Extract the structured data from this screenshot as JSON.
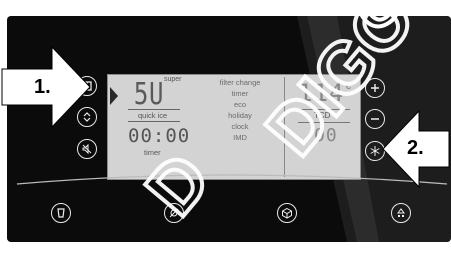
{
  "lcd": {
    "super_label": "super",
    "left_digits": "5U",
    "quick_ice_label": "quick ice",
    "time_digits": "00:00",
    "timer_label": "timer",
    "menu": [
      "filter change",
      "timer",
      "eco",
      "holiday",
      "clock",
      "IMD"
    ],
    "right_digits": "114",
    "deg_symbol": "c",
    "tcd_label": "TCD",
    "right_small_digits": "00"
  },
  "arrows": {
    "left_label": "1.",
    "right_label": "2."
  },
  "buttons": {
    "left": [
      "book-icon",
      "updown-icon",
      "sound-icon"
    ],
    "right": [
      "plus-icon",
      "minus-icon",
      "snowflake-icon"
    ],
    "bottom": [
      "cup-icon",
      "nofrost-icon",
      "box-icon",
      "ice-icon"
    ]
  },
  "watermark": {
    "text": "DIGO CO"
  },
  "colors": {
    "panel": "#0b0b0b",
    "lcd": "#d3d3d3",
    "accent": "#ffffff"
  }
}
